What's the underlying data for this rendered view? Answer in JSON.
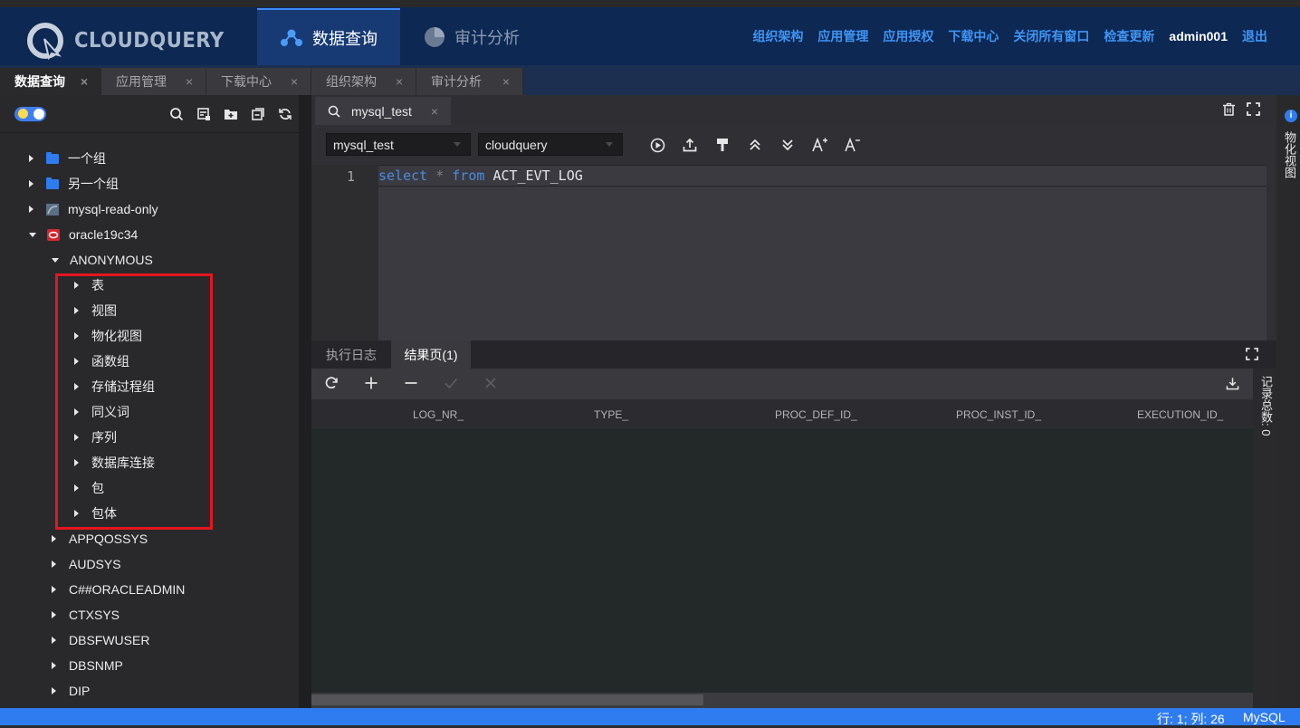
{
  "app": {
    "logo_text": "CLOUDQUERY"
  },
  "header": {
    "tabs": [
      {
        "label": "数据查询"
      },
      {
        "label": "审计分析"
      }
    ],
    "links": [
      "组织架构",
      "应用管理",
      "应用授权",
      "下载中心",
      "关闭所有窗口",
      "检查更新"
    ],
    "user": "admin001",
    "logout": "退出"
  },
  "window_tabs": [
    {
      "label": "数据查询",
      "close": "×"
    },
    {
      "label": "应用管理",
      "close": "×"
    },
    {
      "label": "下载中心",
      "close": "×"
    },
    {
      "label": "组织架构",
      "close": "×"
    },
    {
      "label": "审计分析",
      "close": "×"
    }
  ],
  "tree": [
    {
      "label": "一个组",
      "icon": "folder-icon"
    },
    {
      "label": "另一个组",
      "icon": "folder-icon"
    },
    {
      "label": "mysql-read-only",
      "icon": "mysql-icon"
    },
    {
      "label": "oracle19c34",
      "icon": "oracle-icon"
    },
    {
      "label": "ANONYMOUS"
    },
    {
      "label": "表"
    },
    {
      "label": "视图"
    },
    {
      "label": "物化视图"
    },
    {
      "label": "函数组"
    },
    {
      "label": "存储过程组"
    },
    {
      "label": "同义词"
    },
    {
      "label": "序列"
    },
    {
      "label": "数据库连接"
    },
    {
      "label": "包"
    },
    {
      "label": "包体"
    },
    {
      "label": "APPQOSSYS"
    },
    {
      "label": "AUDSYS"
    },
    {
      "label": "C##ORACLEADMIN"
    },
    {
      "label": "CTXSYS"
    },
    {
      "label": "DBSFWUSER"
    },
    {
      "label": "DBSNMP"
    },
    {
      "label": "DIP"
    }
  ],
  "editor": {
    "tab_label": "mysql_test",
    "tab_close": "×",
    "connection": "mysql_test",
    "database": "cloudquery",
    "line_number": "1",
    "code": {
      "kw1": "select",
      "op": "*",
      "kw2": "from",
      "table": "ACT_EVT_LOG"
    }
  },
  "right_panel": {
    "label": "物化视图",
    "info": "i"
  },
  "results": {
    "tabs": [
      "执行日志",
      "结果页(1)"
    ],
    "columns": [
      "LOG_NR_",
      "TYPE_",
      "PROC_DEF_ID_",
      "PROC_INST_ID_",
      "EXECUTION_ID_"
    ],
    "record_count_label": "记录总数: 0"
  },
  "statusbar": {
    "position": "行: 1; 列: 26",
    "language": "MySQL"
  }
}
